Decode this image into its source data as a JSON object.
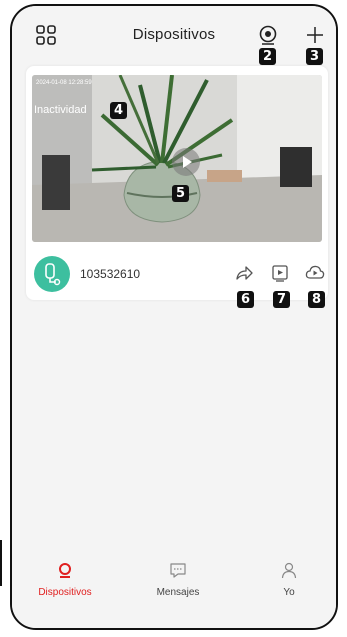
{
  "header": {
    "title": "Dispositivos",
    "menu_icon": "grid-icon",
    "camera_icon": "camera-add-icon",
    "add_icon": "plus-icon"
  },
  "badges": {
    "camera": "2",
    "add": "3",
    "inactivity": "4",
    "play": "5",
    "share": "6",
    "playback": "7",
    "cloud": "8"
  },
  "device_card": {
    "timestamp": "2024-01-08 12:28:59",
    "inactivity_label": "Inactividad",
    "device_id": "103532610",
    "actions": [
      "share-icon",
      "playback-icon",
      "cloud-playback-icon"
    ]
  },
  "tabbar": {
    "tabs": [
      {
        "label": "Dispositivos",
        "icon": "device-icon",
        "active": true
      },
      {
        "label": "Mensajes",
        "icon": "message-icon",
        "active": false
      },
      {
        "label": "Yo",
        "icon": "person-icon",
        "active": false
      }
    ]
  },
  "colors": {
    "accent": "#e02020",
    "avatar_bg": "#3dbf9f",
    "background": "#f4f4f4"
  }
}
